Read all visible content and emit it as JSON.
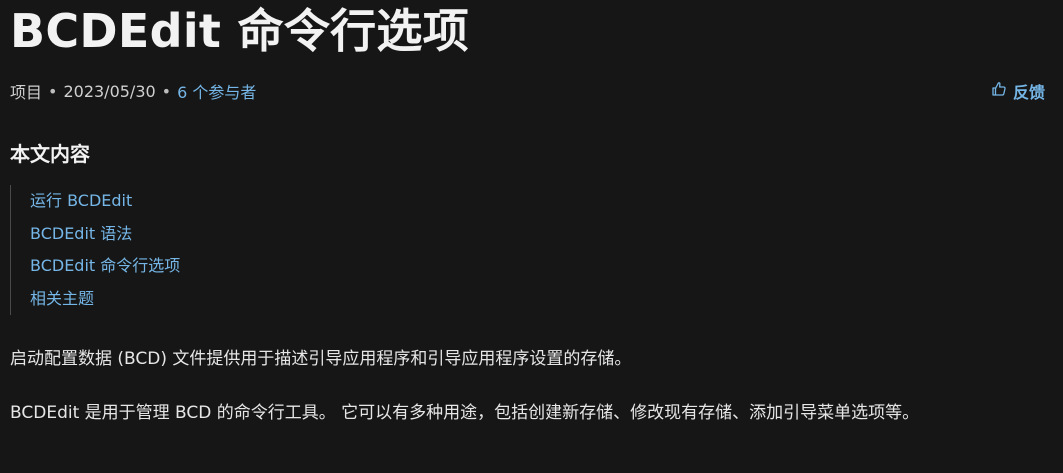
{
  "article": {
    "title": "BCDEdit 命令行选项",
    "meta": {
      "type": "项目",
      "separator": "•",
      "date": "2023/05/30",
      "contributors": "6 个参与者"
    },
    "feedback_label": "反馈",
    "toc": {
      "heading": "本文内容",
      "items": [
        {
          "label": "运行 BCDEdit"
        },
        {
          "label": "BCDEdit 语法"
        },
        {
          "label": "BCDEdit 命令行选项"
        },
        {
          "label": "相关主题"
        }
      ]
    },
    "paragraphs": [
      "启动配置数据 (BCD) 文件提供用于描述引导应用程序和引导应用程序设置的存储。",
      "BCDEdit 是用于管理 BCD 的命令行工具。 它可以有多种用途，包括创建新存储、修改现有存储、添加引导菜单选项等。"
    ]
  },
  "colors": {
    "background": "#161616",
    "text": "#e6e6e6",
    "link": "#75b6e7"
  },
  "icons": {
    "feedback": "thumbs-up-icon"
  }
}
